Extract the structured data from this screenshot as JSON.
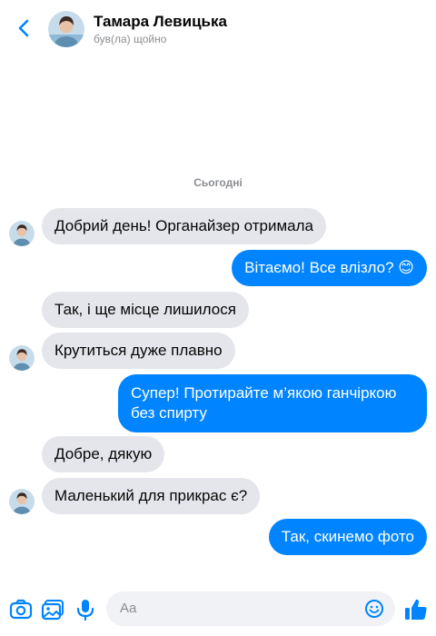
{
  "header": {
    "name": "Тамара Левицька",
    "status": "був(ла) щойно"
  },
  "date_separator": "Сьогодні",
  "messages": [
    {
      "direction": "in",
      "text": "Добрий день! Органайзер отримала",
      "avatar": true
    },
    {
      "direction": "out",
      "text": "Вітаємо! Все влізло? 😊"
    },
    {
      "direction": "in",
      "text": "Так, і ще місце лишилося",
      "avatar": false
    },
    {
      "direction": "in",
      "text": "Крутиться дуже плавно",
      "avatar": true
    },
    {
      "direction": "out",
      "text": "Супер! Протирайте м’якою ганчіркою без спирту"
    },
    {
      "direction": "in",
      "text": "Добре, дякую",
      "avatar": false
    },
    {
      "direction": "in",
      "text": "Маленький для прикрас є?",
      "avatar": true
    },
    {
      "direction": "out",
      "text": "Так, скинемо фото"
    }
  ],
  "composer": {
    "placeholder": "Aa",
    "icons": [
      "camera-icon",
      "image-icon",
      "microphone-icon",
      "emoji-icon",
      "thumbs-up-icon"
    ]
  },
  "colors": {
    "accent": "#0084ff",
    "incoming_bubble": "#e4e6eb",
    "secondary_text": "#8a8d91"
  }
}
